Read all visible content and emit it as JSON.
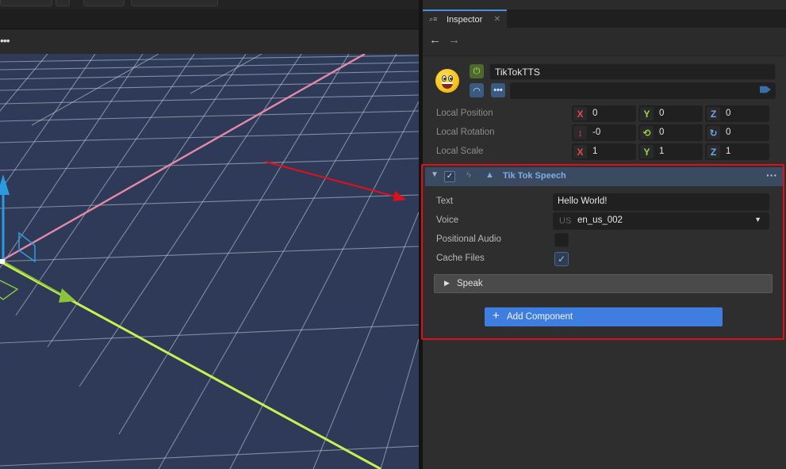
{
  "viewport": {
    "menu_icon": "more-dots-icon"
  },
  "inspector": {
    "tab": {
      "icon": "inspector-icon",
      "label": "Inspector",
      "close_icon": "close-icon"
    },
    "nav": {
      "back_icon": "arrow-left-icon",
      "forward_icon": "arrow-right-icon"
    },
    "object": {
      "avatar_icon": "grinning-emoji-icon",
      "name": "TikTokTTS",
      "enabled_icon": "power-icon",
      "layer_icon": "wifi-icon",
      "options_icon": "more-dots-icon",
      "tag_icon": "tag-icon"
    },
    "transform": [
      {
        "label": "Local Position",
        "axes": [
          {
            "icon": "X",
            "value": "0"
          },
          {
            "icon": "Y",
            "value": "0"
          },
          {
            "icon": "Z",
            "value": "0"
          }
        ]
      },
      {
        "label": "Local Rotation",
        "axes": [
          {
            "icon": "↕",
            "value": "-0"
          },
          {
            "icon": "⟲",
            "value": "0"
          },
          {
            "icon": "↻",
            "value": "0"
          }
        ]
      },
      {
        "label": "Local Scale",
        "axes": [
          {
            "icon": "X",
            "value": "1"
          },
          {
            "icon": "Y",
            "value": "1"
          },
          {
            "icon": "Z",
            "value": "1"
          }
        ]
      }
    ],
    "component": {
      "title": "Tik Tok Speech",
      "enabled": true,
      "fields": {
        "text_label": "Text",
        "text_value": "Hello World!",
        "voice_label": "Voice",
        "voice_flag": "US",
        "voice_value": "en_us_002",
        "positional_label": "Positional Audio",
        "positional_value": false,
        "cache_label": "Cache Files",
        "cache_value": true
      },
      "speak_label": "Speak"
    },
    "add_component_label": "Add Component"
  },
  "colors": {
    "accent_blue": "#3d7ee0",
    "highlight_red": "#e0101a",
    "axis_x": "#e34a4a",
    "axis_y": "#9dd34a",
    "axis_z": "#6fa7ef"
  }
}
